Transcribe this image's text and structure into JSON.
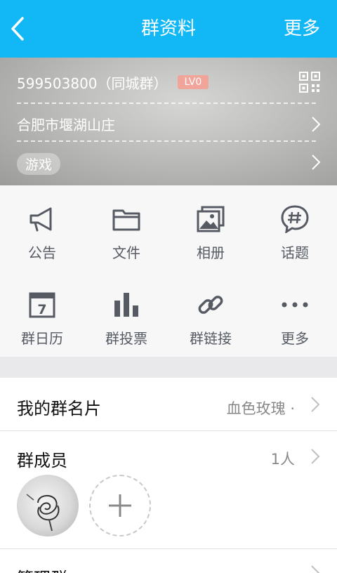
{
  "topbar": {
    "title": "群资料",
    "more": "更多"
  },
  "group": {
    "id_label": "599503800（同城群）",
    "level": "LV0",
    "location": "合肥市堰湖山庄",
    "tag": "游戏"
  },
  "features": [
    {
      "label": "公告",
      "icon": "megaphone-icon"
    },
    {
      "label": "文件",
      "icon": "folder-icon"
    },
    {
      "label": "相册",
      "icon": "album-icon"
    },
    {
      "label": "话题",
      "icon": "topic-icon"
    },
    {
      "label": "群日历",
      "icon": "calendar-icon"
    },
    {
      "label": "群投票",
      "icon": "vote-icon"
    },
    {
      "label": "群链接",
      "icon": "link-icon"
    },
    {
      "label": "更多",
      "icon": "more-dots-icon"
    }
  ],
  "calendar_day": "7",
  "card": {
    "label": "我的群名片",
    "value": "血色玫瑰 ·"
  },
  "members": {
    "label": "群成员",
    "count": "1人"
  },
  "manage": {
    "label": "管理群"
  },
  "colors": {
    "accent": "#12b7f5",
    "icon": "#555a63"
  }
}
